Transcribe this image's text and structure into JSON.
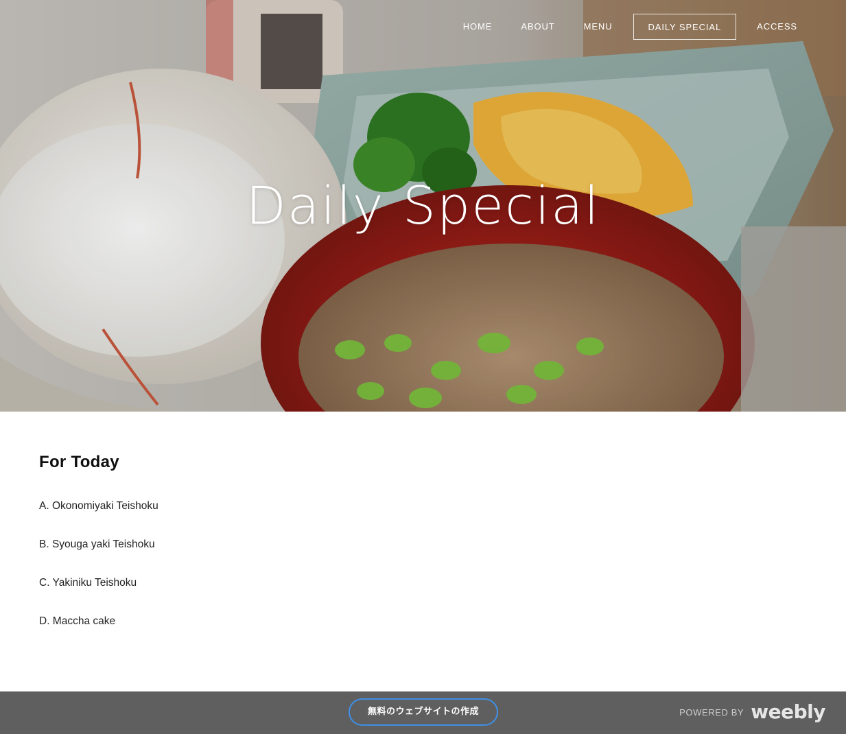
{
  "nav": {
    "items": [
      {
        "label": "HOME",
        "active": false
      },
      {
        "label": "ABOUT",
        "active": false
      },
      {
        "label": "MENU",
        "active": false
      },
      {
        "label": "DAILY SPECIAL",
        "active": true
      },
      {
        "label": "ACCESS",
        "active": false
      }
    ]
  },
  "hero": {
    "title": "Daily Special",
    "image": "japanese-teishoku-meal-photo"
  },
  "content": {
    "heading": "For Today",
    "items": [
      "A. Okonomiyaki Teishoku",
      "B. Syouga yaki Teishoku",
      "C. Yakiniku Teishoku",
      "D. Maccha cake"
    ]
  },
  "footer": {
    "cta_label": "無料のウェブサイトの作成",
    "powered_by": "POWERED BY",
    "brand": "weebly"
  },
  "colors": {
    "footer_bg": "#5f5f5f",
    "cta_border": "#3f8fe6",
    "text": "#111111"
  }
}
